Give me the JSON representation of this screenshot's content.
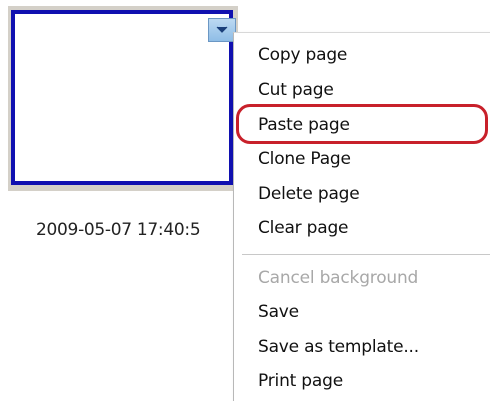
{
  "thumbnail": {
    "timestamp": "2009-05-07 17:40:5"
  },
  "context_menu": {
    "items": [
      {
        "label": "Copy page",
        "enabled": true
      },
      {
        "label": "Cut page",
        "enabled": true
      },
      {
        "label": "Paste page",
        "enabled": true,
        "highlighted": true
      },
      {
        "label": "Clone Page",
        "enabled": true
      },
      {
        "label": "Delete page",
        "enabled": true
      },
      {
        "label": "Clear page",
        "enabled": true
      },
      {
        "label": "Cancel background",
        "enabled": false
      },
      {
        "label": "Save",
        "enabled": true
      },
      {
        "label": "Save as template...",
        "enabled": true
      },
      {
        "label": "Print page",
        "enabled": true
      }
    ]
  },
  "colors": {
    "page_border": "#1010b0",
    "highlight_ring": "#c8202a",
    "dropdown_button": "#8fbde6"
  },
  "icons": {
    "dropdown": "chevron-down-icon"
  }
}
